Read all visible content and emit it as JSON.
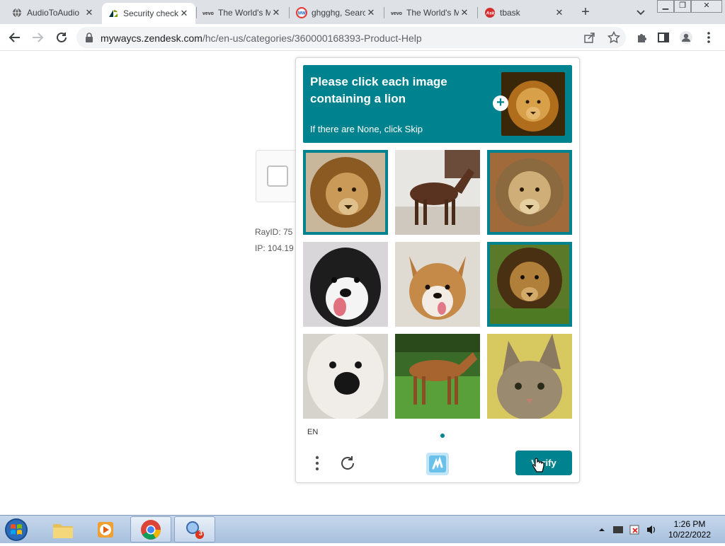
{
  "tabs": [
    {
      "title": "AudioToAudio",
      "favicon": "globe-icon",
      "active": false
    },
    {
      "title": "Security check",
      "favicon": "zendesk-icon",
      "active": true
    },
    {
      "title": "The World's M",
      "favicon": "vevo-icon",
      "active": false
    },
    {
      "title": "ghgghg, Search",
      "favicon": "mw-icon",
      "active": false
    },
    {
      "title": "The World's M",
      "favicon": "vevo-icon",
      "active": false
    },
    {
      "title": "tbask",
      "favicon": "ask-icon",
      "active": false
    }
  ],
  "address_bar": {
    "host": "mywaycs.zendesk.com",
    "path": "/hc/en-us/categories/360000168393-Product-Help"
  },
  "page": {
    "ray_id": "RayID: 75",
    "ip": "IP: 104.19"
  },
  "captcha": {
    "title": "Please click each image containing a lion",
    "subtitle": "If there are None, click Skip",
    "target": "lion",
    "grid": [
      {
        "subject": "lion",
        "selected": true
      },
      {
        "subject": "horse",
        "selected": false
      },
      {
        "subject": "lion",
        "selected": true
      },
      {
        "subject": "dog",
        "selected": false
      },
      {
        "subject": "dog",
        "selected": false
      },
      {
        "subject": "lion",
        "selected": true
      },
      {
        "subject": "dog",
        "selected": false
      },
      {
        "subject": "horse",
        "selected": false
      },
      {
        "subject": "cat",
        "selected": false
      }
    ],
    "language": "EN",
    "verify_label": "Verify",
    "accent_color": "#00838f"
  },
  "taskbar": {
    "items": [
      "explorer",
      "media-player",
      "chrome",
      "task-app"
    ],
    "badge": "3",
    "time": "1:26 PM",
    "date": "10/22/2022"
  }
}
